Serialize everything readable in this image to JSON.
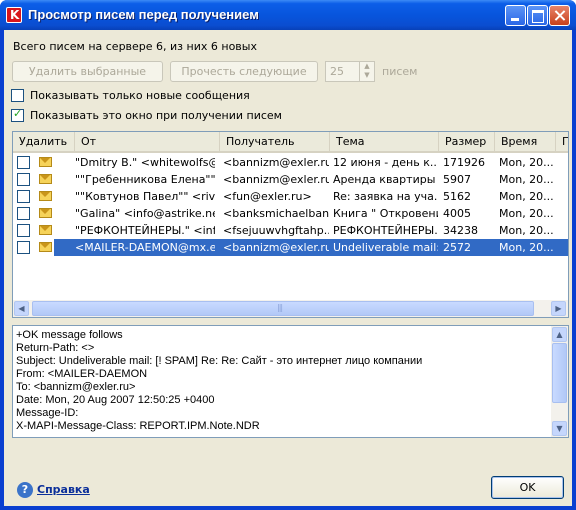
{
  "window": {
    "title": "Просмотр писем перед получением"
  },
  "info_text": "Всего писем на сервере 6, из них 6 новых",
  "toolbar": {
    "delete_selected": "Удалить выбранные",
    "read_next": "Прочесть следующие",
    "count_value": "25",
    "count_unit": "писем"
  },
  "options": {
    "show_only_new": {
      "label": "Показывать только новые сообщения",
      "checked": false
    },
    "show_on_receive": {
      "label": "Показывать это окно при получении писем",
      "checked": true
    }
  },
  "table": {
    "columns": [
      "Удалить",
      "От",
      "Получатель",
      "Тема",
      "Размер",
      "Время",
      "П"
    ],
    "rows": [
      {
        "from": "\"Dmitry B.\" <whitewolfs@...",
        "to": "<bannizm@exler.ru>",
        "subject": "12 июня - день к...",
        "size": "171926",
        "time": "Mon, 20...",
        "selected": false
      },
      {
        "from": "\"\"Гребенникова Елена\"\" ...",
        "to": "<bannizm@exler.ru>",
        "subject": "Аренда квартиры",
        "size": "5907",
        "time": "Mon, 20...",
        "selected": false
      },
      {
        "from": "\"\"Ковтунов Павел\"\" <rive...",
        "to": "<fun@exler.ru>",
        "subject": "Re: заявка на уча...",
        "size": "5162",
        "time": "Mon, 20...",
        "selected": false
      },
      {
        "from": "\"Galina\" <info@astrike.net>",
        "to": "<banksmichaelbank...",
        "subject": "Книга \" Откровения\"",
        "size": "4005",
        "time": "Mon, 20...",
        "selected": false
      },
      {
        "from": "\"РЕФКОНТЕЙНЕРЫ.\" <info...",
        "to": "<fsejuuwvhgftahp...",
        "subject": "РЕФКОНТЕЙНЕРЫ.",
        "size": "34238",
        "time": "Mon, 20...",
        "selected": false
      },
      {
        "from": "<MAILER-DAEMON@mx.e...",
        "to": "<bannizm@exler.ru>",
        "subject": "Undeliverable mail: ...",
        "size": "2572",
        "time": "Mon, 20...",
        "selected": true
      }
    ]
  },
  "message_preview": [
    "+OK message follows",
    "Return-Path: <>",
    "Subject: Undeliverable mail: [! SPAM] Re: Re: Сайт - это интернет лицо компании",
    "From: <MAILER-DAEMON",
    "To: <bannizm@exler.ru>",
    "Date: Mon, 20 Aug 2007 12:50:25 +0400",
    "Message-ID:",
    "X-MAPI-Message-Class: REPORT.IPM.Note.NDR"
  ],
  "footer": {
    "help_label": "Справка",
    "ok_label": "OK"
  }
}
